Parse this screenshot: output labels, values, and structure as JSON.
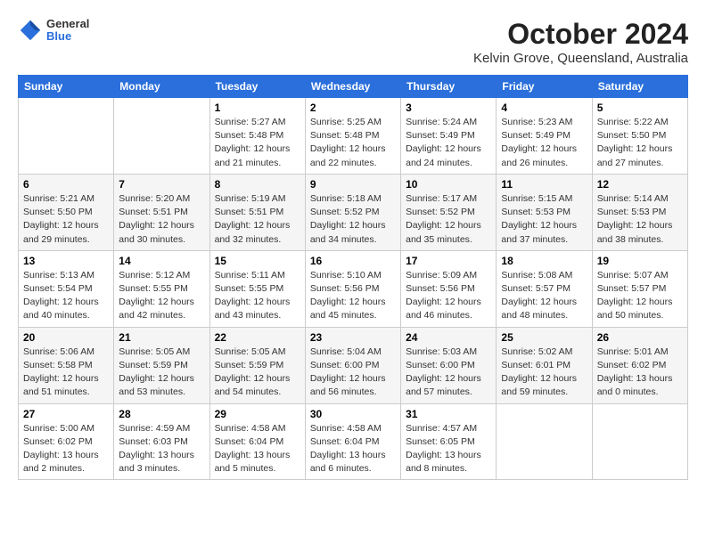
{
  "header": {
    "logo": {
      "general": "General",
      "blue": "Blue"
    },
    "title": "October 2024",
    "subtitle": "Kelvin Grove, Queensland, Australia"
  },
  "calendar": {
    "headers": [
      "Sunday",
      "Monday",
      "Tuesday",
      "Wednesday",
      "Thursday",
      "Friday",
      "Saturday"
    ],
    "weeks": [
      [
        {
          "day": null,
          "info": null
        },
        {
          "day": null,
          "info": null
        },
        {
          "day": "1",
          "info": "Sunrise: 5:27 AM\nSunset: 5:48 PM\nDaylight: 12 hours and 21 minutes."
        },
        {
          "day": "2",
          "info": "Sunrise: 5:25 AM\nSunset: 5:48 PM\nDaylight: 12 hours and 22 minutes."
        },
        {
          "day": "3",
          "info": "Sunrise: 5:24 AM\nSunset: 5:49 PM\nDaylight: 12 hours and 24 minutes."
        },
        {
          "day": "4",
          "info": "Sunrise: 5:23 AM\nSunset: 5:49 PM\nDaylight: 12 hours and 26 minutes."
        },
        {
          "day": "5",
          "info": "Sunrise: 5:22 AM\nSunset: 5:50 PM\nDaylight: 12 hours and 27 minutes."
        }
      ],
      [
        {
          "day": "6",
          "info": "Sunrise: 5:21 AM\nSunset: 5:50 PM\nDaylight: 12 hours and 29 minutes."
        },
        {
          "day": "7",
          "info": "Sunrise: 5:20 AM\nSunset: 5:51 PM\nDaylight: 12 hours and 30 minutes."
        },
        {
          "day": "8",
          "info": "Sunrise: 5:19 AM\nSunset: 5:51 PM\nDaylight: 12 hours and 32 minutes."
        },
        {
          "day": "9",
          "info": "Sunrise: 5:18 AM\nSunset: 5:52 PM\nDaylight: 12 hours and 34 minutes."
        },
        {
          "day": "10",
          "info": "Sunrise: 5:17 AM\nSunset: 5:52 PM\nDaylight: 12 hours and 35 minutes."
        },
        {
          "day": "11",
          "info": "Sunrise: 5:15 AM\nSunset: 5:53 PM\nDaylight: 12 hours and 37 minutes."
        },
        {
          "day": "12",
          "info": "Sunrise: 5:14 AM\nSunset: 5:53 PM\nDaylight: 12 hours and 38 minutes."
        }
      ],
      [
        {
          "day": "13",
          "info": "Sunrise: 5:13 AM\nSunset: 5:54 PM\nDaylight: 12 hours and 40 minutes."
        },
        {
          "day": "14",
          "info": "Sunrise: 5:12 AM\nSunset: 5:55 PM\nDaylight: 12 hours and 42 minutes."
        },
        {
          "day": "15",
          "info": "Sunrise: 5:11 AM\nSunset: 5:55 PM\nDaylight: 12 hours and 43 minutes."
        },
        {
          "day": "16",
          "info": "Sunrise: 5:10 AM\nSunset: 5:56 PM\nDaylight: 12 hours and 45 minutes."
        },
        {
          "day": "17",
          "info": "Sunrise: 5:09 AM\nSunset: 5:56 PM\nDaylight: 12 hours and 46 minutes."
        },
        {
          "day": "18",
          "info": "Sunrise: 5:08 AM\nSunset: 5:57 PM\nDaylight: 12 hours and 48 minutes."
        },
        {
          "day": "19",
          "info": "Sunrise: 5:07 AM\nSunset: 5:57 PM\nDaylight: 12 hours and 50 minutes."
        }
      ],
      [
        {
          "day": "20",
          "info": "Sunrise: 5:06 AM\nSunset: 5:58 PM\nDaylight: 12 hours and 51 minutes."
        },
        {
          "day": "21",
          "info": "Sunrise: 5:05 AM\nSunset: 5:59 PM\nDaylight: 12 hours and 53 minutes."
        },
        {
          "day": "22",
          "info": "Sunrise: 5:05 AM\nSunset: 5:59 PM\nDaylight: 12 hours and 54 minutes."
        },
        {
          "day": "23",
          "info": "Sunrise: 5:04 AM\nSunset: 6:00 PM\nDaylight: 12 hours and 56 minutes."
        },
        {
          "day": "24",
          "info": "Sunrise: 5:03 AM\nSunset: 6:00 PM\nDaylight: 12 hours and 57 minutes."
        },
        {
          "day": "25",
          "info": "Sunrise: 5:02 AM\nSunset: 6:01 PM\nDaylight: 12 hours and 59 minutes."
        },
        {
          "day": "26",
          "info": "Sunrise: 5:01 AM\nSunset: 6:02 PM\nDaylight: 13 hours and 0 minutes."
        }
      ],
      [
        {
          "day": "27",
          "info": "Sunrise: 5:00 AM\nSunset: 6:02 PM\nDaylight: 13 hours and 2 minutes."
        },
        {
          "day": "28",
          "info": "Sunrise: 4:59 AM\nSunset: 6:03 PM\nDaylight: 13 hours and 3 minutes."
        },
        {
          "day": "29",
          "info": "Sunrise: 4:58 AM\nSunset: 6:04 PM\nDaylight: 13 hours and 5 minutes."
        },
        {
          "day": "30",
          "info": "Sunrise: 4:58 AM\nSunset: 6:04 PM\nDaylight: 13 hours and 6 minutes."
        },
        {
          "day": "31",
          "info": "Sunrise: 4:57 AM\nSunset: 6:05 PM\nDaylight: 13 hours and 8 minutes."
        },
        {
          "day": null,
          "info": null
        },
        {
          "day": null,
          "info": null
        }
      ]
    ]
  }
}
